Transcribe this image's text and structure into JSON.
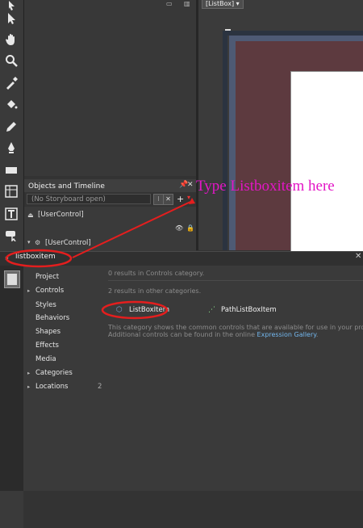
{
  "document": {
    "tab_label": "[ListBox] ▾"
  },
  "objects_panel": {
    "title": "Objects and Timeline",
    "pin_icon": "pin-icon",
    "close_icon": "close-icon",
    "storyboard_text": "(No Storyboard open)",
    "add_label": "+",
    "tree": {
      "item1": "[UserControl]",
      "item2": "[UserControl]"
    }
  },
  "annotation": {
    "text": "Type Listboxitem here",
    "color": "#e316c6",
    "highlight_color": "#e41e1e"
  },
  "assets": {
    "search_value": "listboxitem",
    "categories": [
      {
        "label": "Project",
        "arrow": "",
        "count": ""
      },
      {
        "label": "Controls",
        "arrow": "▸",
        "count": ""
      },
      {
        "label": "Styles",
        "arrow": "",
        "count": ""
      },
      {
        "label": "Behaviors",
        "arrow": "",
        "count": ""
      },
      {
        "label": "Shapes",
        "arrow": "",
        "count": ""
      },
      {
        "label": "Effects",
        "arrow": "",
        "count": ""
      },
      {
        "label": "Media",
        "arrow": "",
        "count": ""
      },
      {
        "label": "Categories",
        "arrow": "▸",
        "count": ""
      },
      {
        "label": "Locations",
        "arrow": "▸",
        "count": "2"
      }
    ],
    "results_in_category": "0 results in Controls category.",
    "results_other": "2 results in other categories.",
    "items": [
      {
        "label": "ListBoxItem",
        "icon": "listboxitem-icon"
      },
      {
        "label": "PathListBoxItem",
        "icon": "pathlistboxitem-icon"
      }
    ],
    "description_line1": "This category shows the common controls that are available for use in your proje",
    "description_line2": "Additional controls can be found in the online ",
    "description_link": "Expression Gallery",
    "description_end": "."
  }
}
